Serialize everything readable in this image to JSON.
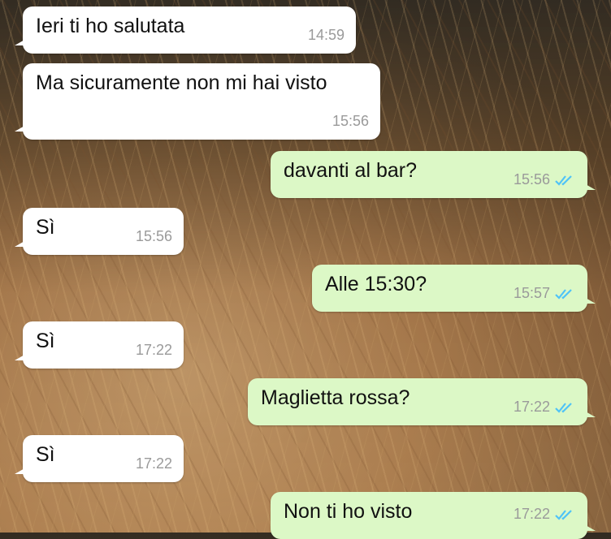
{
  "colors": {
    "incoming_bubble": "#ffffff",
    "outgoing_bubble": "#dcf8c6",
    "tick_blue": "#4fc3f7",
    "timestamp": "#9a9a9a"
  },
  "messages": [
    {
      "dir": "in",
      "text": "Ieri ti ho salutata",
      "time": "14:59"
    },
    {
      "dir": "in",
      "text": "Ma sicuramente non mi hai visto",
      "time": "15:56"
    },
    {
      "dir": "out",
      "text": "davanti al bar?",
      "time": "15:56",
      "status": "read-double-check-icon"
    },
    {
      "dir": "in",
      "text": "Sì",
      "time": "15:56"
    },
    {
      "dir": "out",
      "text": "Alle 15:30?",
      "time": "15:57",
      "status": "read-double-check-icon"
    },
    {
      "dir": "in",
      "text": "Sì",
      "time": "17:22"
    },
    {
      "dir": "out",
      "text": "Maglietta rossa?",
      "time": "17:22",
      "status": "read-double-check-icon"
    },
    {
      "dir": "in",
      "text": "Sì",
      "time": "17:22"
    },
    {
      "dir": "out",
      "text": "Non ti ho visto",
      "time": "17:22",
      "status": "read-double-check-icon"
    }
  ]
}
